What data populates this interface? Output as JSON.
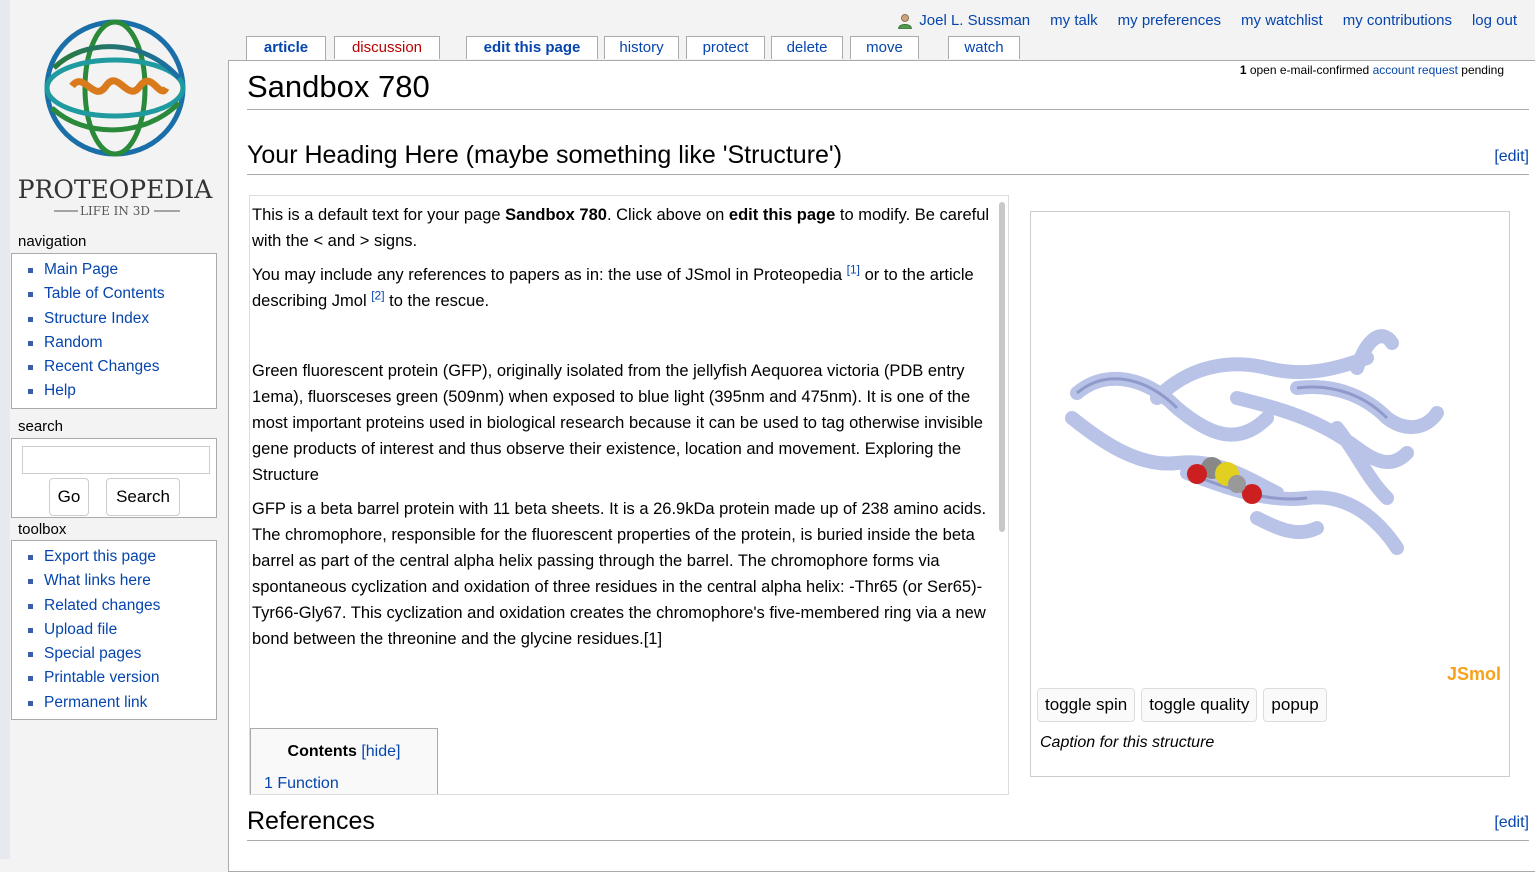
{
  "personal": {
    "user": "Joel L. Sussman",
    "links": [
      "my talk",
      "my preferences",
      "my watchlist",
      "my contributions",
      "log out"
    ]
  },
  "tabs": [
    {
      "label": "article"
    },
    {
      "label": "discussion"
    },
    {
      "label": "edit this page"
    },
    {
      "label": "history"
    },
    {
      "label": "protect"
    },
    {
      "label": "delete"
    },
    {
      "label": "move"
    },
    {
      "label": "watch"
    }
  ],
  "site_notice": {
    "count": "1",
    "text_before": " open e-mail-confirmed ",
    "link": "account request",
    "text_after": " pending"
  },
  "logo": {
    "title": "PROTEOPEDIA",
    "subtitle": "LIFE IN 3D"
  },
  "page_title": "Sandbox 780",
  "section1": {
    "heading": "Your Heading Here (maybe something like 'Structure')",
    "edit": "[edit]"
  },
  "section2": {
    "heading": "References",
    "edit": "[edit]"
  },
  "body": {
    "p1_a": "This is a default text for your page ",
    "p1_b": "Sandbox 780",
    "p1_c": ". Click above on ",
    "p1_d": "edit this page",
    "p1_e": " to modify. Be careful with the < and > signs.",
    "p2_a": "You may include any references to papers as in: the use of JSmol in Proteopedia ",
    "p2_ref1": "[1]",
    "p2_b": " or to the article describing Jmol ",
    "p2_ref2": "[2]",
    "p2_c": " to the rescue.",
    "p3": "Green fluorescent protein (GFP), originally isolated from the jellyfish Aequorea victoria (PDB entry 1ema), fluorsceses green (509nm) when exposed to blue light (395nm and 475nm). It is one of the most important proteins used in biological research because it can be used to tag otherwise invisible gene products of interest and thus observe their existence, location and movement. Exploring the Structure",
    "p4": "GFP is a beta barrel protein with 11 beta sheets. It is a 26.9kDa protein made up of 238 amino acids. The chromophore, responsible for the fluorescent properties of the protein, is buried inside the beta barrel as part of the central alpha helix passing through the barrel. The chromophore forms via spontaneous cyclization and oxidation of three residues in the central alpha helix: -Thr65 (or Ser65)-Tyr66-Gly67. This cyclization and oxidation creates the chromophore's five-membered ring via a new bond between the threonine and the glycine residues.[1]"
  },
  "toc": {
    "title": "Contents",
    "hide": "[hide]",
    "items": [
      {
        "number": "1",
        "label": "Function"
      }
    ]
  },
  "jmol": {
    "brand": "JSmol",
    "buttons": [
      "toggle spin",
      "toggle quality",
      "popup"
    ],
    "caption": "Caption for this structure"
  },
  "navigation": {
    "title": "navigation",
    "items": [
      "Main Page",
      "Table of Contents",
      "Structure Index",
      "Random",
      "Recent Changes",
      "Help"
    ]
  },
  "search": {
    "title": "search",
    "go": "Go",
    "search": "Search",
    "value": ""
  },
  "toolbox": {
    "title": "toolbox",
    "items": [
      "Export this page",
      "What links here",
      "Related changes",
      "Upload file",
      "Special pages",
      "Printable version",
      "Permanent link"
    ]
  },
  "colors": {
    "link": "#0645ad",
    "new_link": "#ba0000",
    "jsmol": "#f7a21a",
    "protein": "#b9c3e8"
  }
}
